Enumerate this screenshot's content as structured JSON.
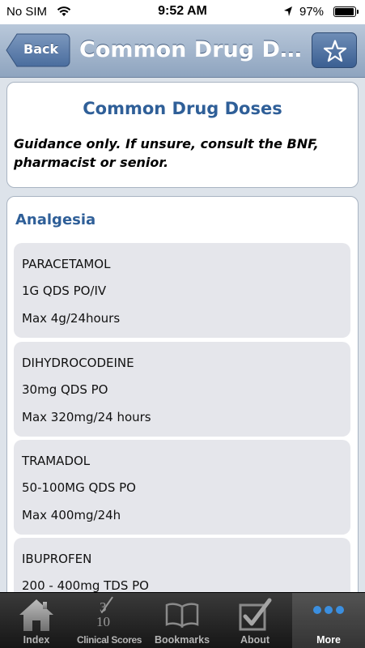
{
  "status": {
    "carrier": "No SIM",
    "time": "9:52 AM",
    "battery": "97%",
    "battery_level": 0.97
  },
  "nav": {
    "back_label": "Back",
    "title": "Common Drug Dos…"
  },
  "header": {
    "title": "Common Drug Doses",
    "note": "Guidance only. If unsure, consult the BNF, pharmacist or senior."
  },
  "section": {
    "title": "Analgesia",
    "drugs": [
      {
        "name": "PARACETAMOL",
        "dose": "1G QDS PO/IV",
        "max": "Max 4g/24hours"
      },
      {
        "name": "DIHYDROCODEINE",
        "dose": "30mg QDS PO",
        "max": "Max 320mg/24 hours"
      },
      {
        "name": "TRAMADOL",
        "dose": "50-100MG QDS PO",
        "max": "Max 400mg/24h"
      },
      {
        "name": "IBUPROFEN",
        "dose": "200 - 400mg TDS PO",
        "max": ""
      }
    ]
  },
  "tabs": {
    "index": "Index",
    "clinical_scores": "Clinical Scores",
    "clinical_scores_icon_num": "3",
    "clinical_scores_icon_den": "10",
    "bookmarks": "Bookmarks",
    "about": "About",
    "more": "More"
  },
  "colors": {
    "accent": "#2f5f98",
    "nav": "#8ea4bf",
    "tab_active_dot": "#3b8fe0"
  }
}
